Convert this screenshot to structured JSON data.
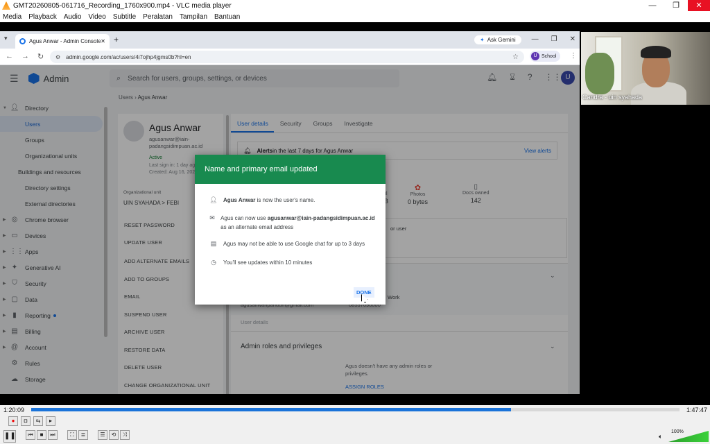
{
  "vlc": {
    "title": "GMT20260805-061716_Recording_1760x900.mp4 - VLC media player",
    "menu": [
      "Media",
      "Playback",
      "Audio",
      "Video",
      "Subtitle",
      "Peralatan",
      "Tampilan",
      "Bantuan"
    ],
    "time_current": "1:20:09",
    "time_total": "1:47:47",
    "progress": 0.74,
    "volume": "100%"
  },
  "browser": {
    "tab_title": "Agus Anwar - Admin Console",
    "new_tab": "+",
    "gemini_label": "Ask Gemini",
    "url": "admin.google.com/ac/users/4i7ojhp4jgms0b?hl=en",
    "profile_label": "School",
    "profile_initial": "U"
  },
  "admin": {
    "app_name": "Admin",
    "search_placeholder": "Search for users, groups, settings, or devices",
    "avatar_initial": "U",
    "breadcrumb_parent": "Users",
    "breadcrumb_current": "Agus Anwar",
    "sidebar": [
      {
        "label": "Directory",
        "icon": "person-icon",
        "caret": true,
        "level": 0
      },
      {
        "label": "Users",
        "level": 1,
        "active": true
      },
      {
        "label": "Groups",
        "level": 1
      },
      {
        "label": "Organizational units",
        "level": 1
      },
      {
        "label": "Buildings and resources",
        "level": 1,
        "caret": true
      },
      {
        "label": "Directory settings",
        "level": 1
      },
      {
        "label": "External directories",
        "level": 1
      },
      {
        "label": "Chrome browser",
        "icon": "chrome-icon",
        "caret": true,
        "level": 0
      },
      {
        "label": "Devices",
        "icon": "devices-icon",
        "caret": true,
        "level": 0
      },
      {
        "label": "Apps",
        "icon": "apps-icon",
        "caret": true,
        "level": 0
      },
      {
        "label": "Generative AI",
        "icon": "sparkle-icon",
        "caret": true,
        "level": 0
      },
      {
        "label": "Security",
        "icon": "shield-icon",
        "caret": true,
        "level": 0
      },
      {
        "label": "Data",
        "icon": "data-icon",
        "caret": true,
        "level": 0
      },
      {
        "label": "Reporting",
        "icon": "chart-icon",
        "caret": true,
        "level": 0,
        "dot": true
      },
      {
        "label": "Billing",
        "icon": "billing-icon",
        "caret": true,
        "level": 0
      },
      {
        "label": "Account",
        "icon": "at-icon",
        "caret": true,
        "level": 0
      },
      {
        "label": "Rules",
        "icon": "rules-icon",
        "level": 0
      },
      {
        "label": "Storage",
        "icon": "cloud-icon",
        "level": 0
      }
    ],
    "user": {
      "name": "Agus Anwar",
      "email": "agusanwar@iain-padangsidimpuan.ac.id",
      "status": "Active",
      "last_sign_in": "Last sign in: 1 day ago",
      "created": "Created: Aug 16, 2023",
      "org_unit_label": "Organizational unit",
      "org_unit_path": "UIN SYAHADA  >  FEBI"
    },
    "actions": [
      "RESET PASSWORD",
      "UPDATE USER",
      "ADD ALTERNATE EMAILS",
      "ADD TO GROUPS",
      "EMAIL",
      "SUSPEND USER",
      "ARCHIVE USER",
      "RESTORE DATA",
      "DELETE USER",
      "CHANGE ORGANIZATIONAL UNIT"
    ],
    "tabs": [
      "User details",
      "Security",
      "Groups",
      "Investigate"
    ],
    "alerts": {
      "prefix": "Alerts",
      "text": " in the last 7 days for Agus Anwar",
      "link": "View alerts"
    },
    "stats": [
      {
        "label": "il",
        "value": "B"
      },
      {
        "label": "Photos",
        "value": "0 bytes"
      },
      {
        "label": "Docs owned",
        "value": "142"
      }
    ],
    "org_text": "or user",
    "contact": {
      "email": "agusanwaripanuuri@gmail.com",
      "phone": "08537090000",
      "work": "Work",
      "details_link": "User details"
    },
    "roles": {
      "title": "Admin roles and privileges",
      "desc": "Agus doesn't have any admin roles or privileges.",
      "assign": "ASSIGN ROLES"
    }
  },
  "dialog": {
    "title": "Name and primary email updated",
    "line1_bold": "Agus Anwar",
    "line1_rest": " is now the user's name.",
    "line2_pre": "Agus can now use ",
    "line2_bold": "agusanwar@iain-padangsidimpuan.ac.id",
    "line2_rest": " as an alternate email address",
    "line3": "Agus may not be able to use Google chat for up to 3 days",
    "line4": "You'll see updates within 10 minutes",
    "done": "DONE"
  },
  "camera": {
    "label": "Candra - uin syahada"
  }
}
